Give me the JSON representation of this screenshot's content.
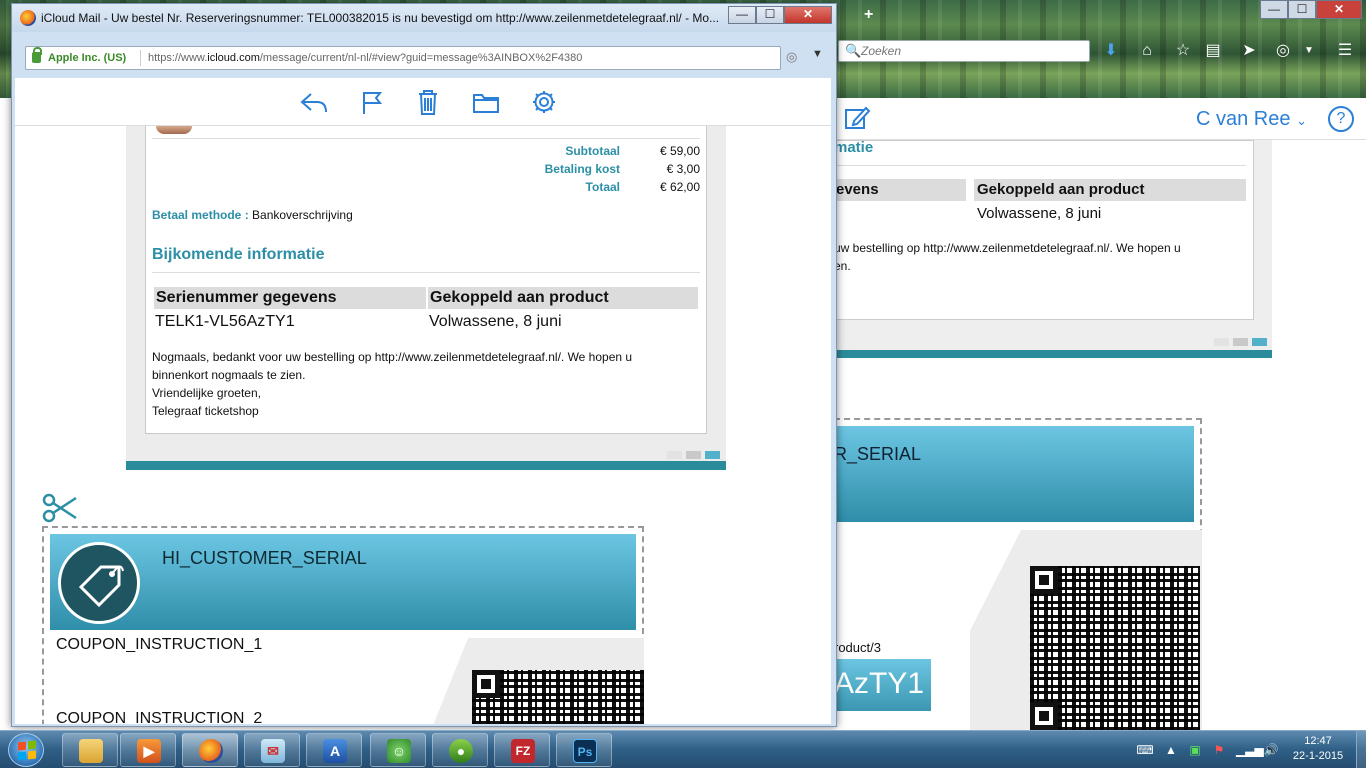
{
  "background_window": {
    "search_placeholder": "Zoeken",
    "user_name": "C van Ree",
    "user_chevron": "⌄",
    "help_glyph": "?",
    "tab_plus": "+",
    "card": {
      "heading_fragment": "matie",
      "col2_header": "Gekoppeld aan product",
      "col1_header_fragment": "evens",
      "col2_value": "Volwassene, 8 juni",
      "message_line1": "uw bestelling op http://www.zeilenmetdetelegraaf.nl/. We hopen u",
      "message_line2": "en."
    },
    "coupon": {
      "serial_fragment": "R_SERIAL",
      "product_fragment": "roduct/3",
      "code_fragment": "AzTY1"
    }
  },
  "popup": {
    "title": "iCloud Mail - Uw bestel Nr. Reserveringsnummer: TEL000382015 is nu bevestigd om http://www.zeilenmetdetelegraaf.nl/ - Mo...",
    "minimize_glyph": "—",
    "maximize_glyph": "☐",
    "close_glyph": "✕",
    "site_identity": "Apple Inc. (US)",
    "url_prefix": "https://www.",
    "url_domain": "icloud.com",
    "url_path": "/message/current/nl-nl/#view?guid=message%3AINBOX%2F4380",
    "email": {
      "totals": [
        {
          "label": "Subtotaal",
          "value": "€ 59,00"
        },
        {
          "label": "Betaling kost",
          "value": "€ 3,00"
        },
        {
          "label": "Totaal",
          "value": "€ 62,00"
        }
      ],
      "payment_label": "Betaal methode",
      "payment_sep": " : ",
      "payment_value": "Bankoverschrijving",
      "extra_heading": "Bijkomende informatie",
      "table": {
        "headers": [
          "Serienummer gegevens",
          "Gekoppeld aan product"
        ],
        "row": [
          "TELK1-VL56AzTY1",
          "Volwassene, 8 juni"
        ]
      },
      "message_lines": [
        "Nogmaals, bedankt voor uw bestelling op http://www.zeilenmetdetelegraaf.nl/. We hopen u",
        "binnenkort nogmaals te zien.",
        "Vriendelijke groeten,",
        "Telegraaf ticketshop"
      ]
    },
    "coupon": {
      "serial_placeholder": "HI_CUSTOMER_SERIAL",
      "instruction_1": "COUPON_INSTRUCTION_1",
      "instruction_2": "COUPON_INSTRUCTION_2"
    }
  },
  "taskbar": {
    "time": "12:47",
    "date": "22-1-2015",
    "apps": [
      "explorer",
      "media-player",
      "firefox",
      "mail",
      "ares",
      "network",
      "pea",
      "filezilla",
      "photoshop"
    ],
    "filezilla_glyph": "FZ",
    "photoshop_glyph": "Ps"
  },
  "colors": {
    "accent_teal": "#2c8fa6",
    "icloud_blue": "#2b7fd6",
    "banner_top": "#6cc6e3",
    "banner_bottom": "#2f8ea9",
    "bar_teal": "#2a8c9a"
  }
}
